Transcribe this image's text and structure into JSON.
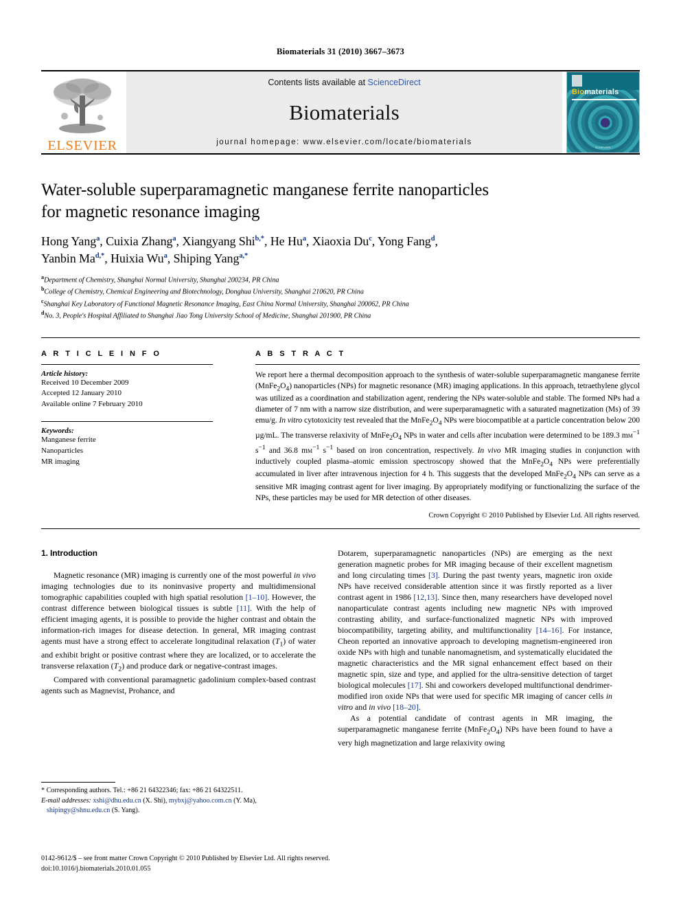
{
  "running_head": "Biomaterials 31 (2010) 3667–3673",
  "header": {
    "publisher_name": "ELSEVIER",
    "contents_prefix": "Contents lists available at ",
    "contents_link": "ScienceDirect",
    "journal_title": "Biomaterials",
    "homepage": "journal homepage: www.elsevier.com/locate/biomaterials",
    "cover": {
      "brand_first": "Bio",
      "brand_rest": "materials",
      "footer_text": "ELSEVIER"
    }
  },
  "article": {
    "title_line1": "Water-soluble superparamagnetic manganese ferrite nanoparticles",
    "title_line2": "for magnetic resonance imaging",
    "authors_line1": "Hong Yang a, Cuixia Zhang a, Xiangyang Shi b,*, He Hu a, Xiaoxia Du c, Yong Fang d,",
    "authors_line2": "Yanbin Ma d,*, Huixia Wu a, Shiping Yang a,*",
    "affiliations": [
      {
        "mark": "a",
        "text": "Department of Chemistry, Shanghai Normal University, Shanghai 200234, PR China"
      },
      {
        "mark": "b",
        "text": "College of Chemistry, Chemical Engineering and Biotechnology, Donghua University, Shanghai 210620, PR China"
      },
      {
        "mark": "c",
        "text": "Shanghai Key Laboratory of Functional Magnetic Resonance Imaging, East China Normal University, Shanghai 200062, PR China"
      },
      {
        "mark": "d",
        "text": "No. 3, People's Hospital Affiliated to Shanghai Jiao Tong University School of Medicine, Shanghai 201900, PR China"
      }
    ]
  },
  "article_info": {
    "heading": "A R T I C L E  I N F O",
    "history_label": "Article history:",
    "history": [
      "Received 10 December 2009",
      "Accepted 12 January 2010",
      "Available online 7 February 2010"
    ],
    "keywords_label": "Keywords:",
    "keywords": [
      "Manganese ferrite",
      "Nanoparticles",
      "MR imaging"
    ]
  },
  "abstract": {
    "heading": "A B S T R A C T",
    "copyright": "Crown Copyright © 2010 Published by Elsevier Ltd. All rights reserved."
  },
  "introduction": {
    "heading": "1.  Introduction"
  },
  "footnotes": {
    "corresponding": "* Corresponding authors. Tel.: +86 21 64322346; fax: +86 21 64322511.",
    "email_label": "E-mail addresses:",
    "emails": [
      {
        "address": "xshi@dhu.edu.cn",
        "person": "(X. Shi)"
      },
      {
        "address": "mybxj@yahoo.com.cn",
        "person": "(Y. Ma)"
      },
      {
        "address": "shipingy@shnu.edu.cn",
        "person": "(S. Yang)"
      }
    ]
  },
  "footer": {
    "issn_line": "0142-9612/$ – see front matter Crown Copyright © 2010 Published by Elsevier Ltd. All rights reserved.",
    "doi_line": "doi:10.1016/j.biomaterials.2010.01.055"
  },
  "colors": {
    "link_blue": "#13358c",
    "sciencedirect_blue": "#2b57b5",
    "elsevier_orange": "#F07D18",
    "band_gray": "#ececec"
  }
}
